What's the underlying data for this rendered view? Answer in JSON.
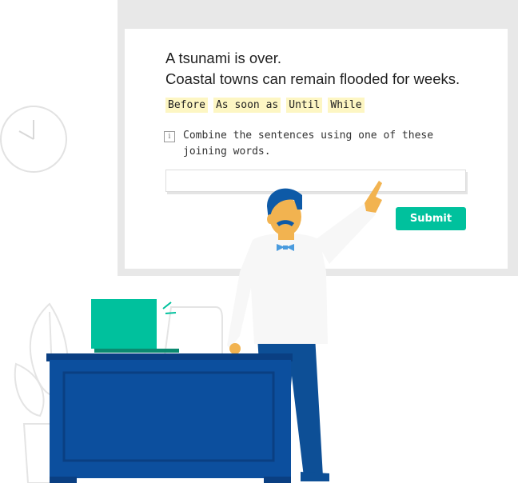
{
  "exercise": {
    "sentences": [
      "A tsunami is over.",
      "Coastal towns can remain flooded for weeks."
    ],
    "joining_words": [
      "Before",
      "As soon as",
      "Until",
      "While"
    ],
    "instruction": "Combine the sentences using one of these joining words.",
    "info_icon": "i",
    "answer_value": "",
    "submit_label": "Submit"
  },
  "colors": {
    "accent": "#00c19d",
    "highlight": "#fdf6c3",
    "desk": "#0c4f9e",
    "trousers": "#0d4f96",
    "hair": "#0e5aa7",
    "skin": "#f2b350"
  }
}
